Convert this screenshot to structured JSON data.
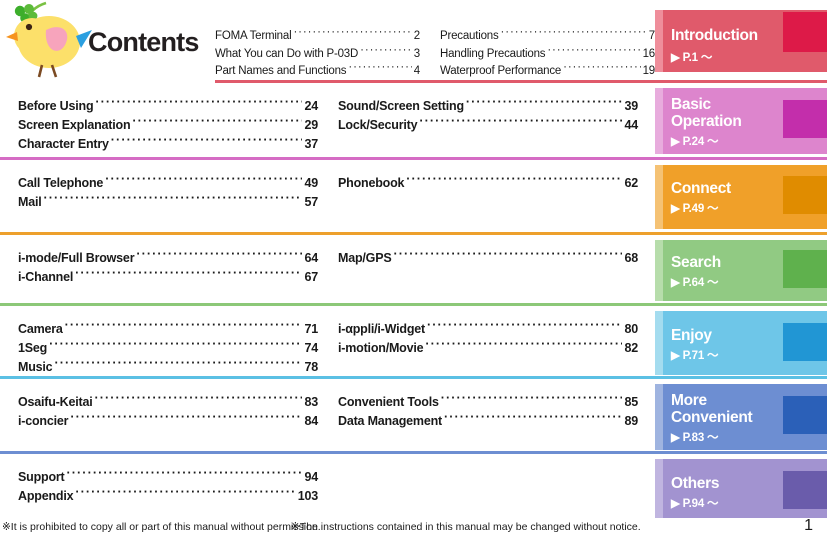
{
  "page": {
    "title": "Contents",
    "page_number": "1",
    "mascot_icon": "chick-with-clover-icon"
  },
  "footer": {
    "note_left": "※It is prohibited to copy all or part of this manual without permission.",
    "note_right": "※The instructions contained in this manual may be changed without notice."
  },
  "colors": {
    "introduction": "#e05a6b",
    "introduction_accent": "#ef8e9b",
    "introduction_square": "#dd1a48",
    "basic_operation": "#dd85cd",
    "basic_operation_accent": "#e8acdd",
    "basic_operation_square": "#c32eab",
    "connect": "#f0a029",
    "connect_accent": "#f5c274",
    "connect_square": "#e08c00",
    "search": "#91ca83",
    "search_accent": "#b7ddab",
    "search_square": "#5fb14d",
    "enjoy": "#6ec6e8",
    "enjoy_accent": "#a4dcef",
    "enjoy_square": "#2196d4",
    "more_convenient": "#6d8ed2",
    "more_convenient_accent": "#9fb4e0",
    "more_convenient_square": "#2b60b8",
    "others": "#a293d0",
    "others_accent": "#c0b5e0",
    "others_square": "#6a5cab"
  },
  "sections": [
    {
      "tab_label": "Introduction",
      "tab_page": "▶ P.1 ～",
      "rule_color": "#e05a6b",
      "left": [
        {
          "title": "FOMA Terminal",
          "page": "2"
        },
        {
          "title": "What You can Do with P-03D",
          "page": "3"
        },
        {
          "title": "Part Names and Functions",
          "page": "4"
        }
      ],
      "right": [
        {
          "title": "Precautions",
          "page": "7"
        },
        {
          "title": "Handling Precautions",
          "page": "16"
        },
        {
          "title": "Waterproof Performance",
          "page": "19"
        }
      ]
    },
    {
      "tab_label": "Basic Operation",
      "tab_page": "▶ P.24 ～",
      "rule_color": "#d56cc4",
      "left": [
        {
          "title": "Before Using",
          "page": "24"
        },
        {
          "title": "Screen Explanation",
          "page": "29"
        },
        {
          "title": "Character Entry",
          "page": "37"
        }
      ],
      "right": [
        {
          "title": "Sound/Screen Setting",
          "page": "39"
        },
        {
          "title": "Lock/Security",
          "page": "44"
        }
      ]
    },
    {
      "tab_label": "Connect",
      "tab_page": "▶ P.49 ～",
      "rule_color": "#eda02c",
      "left": [
        {
          "title": "Call Telephone",
          "page": "49"
        },
        {
          "title": "Mail",
          "page": "57"
        }
      ],
      "right": [
        {
          "title": "Phonebook",
          "page": "62"
        }
      ]
    },
    {
      "tab_label": "Search",
      "tab_page": "▶ P.64 ～",
      "rule_color": "#8cc878",
      "left": [
        {
          "title": "i-mode/Full Browser",
          "page": "64"
        },
        {
          "title": "i-Channel",
          "page": "67"
        }
      ],
      "right": [
        {
          "title": "Map/GPS",
          "page": "68"
        }
      ]
    },
    {
      "tab_label": "Enjoy",
      "tab_page": "▶ P.71 ～",
      "rule_color": "#5bc0e4",
      "left": [
        {
          "title": "Camera",
          "page": "71"
        },
        {
          "title": "1Seg",
          "page": "74"
        },
        {
          "title": "Music",
          "page": "78"
        }
      ],
      "right": [
        {
          "title": "i-αppli/i-Widget",
          "page": "80"
        },
        {
          "title": "i-motion/Movie",
          "page": "82"
        }
      ]
    },
    {
      "tab_label": "More Convenient",
      "tab_page": "▶ P.83 ～",
      "rule_color": "#6d8ed2",
      "left": [
        {
          "title": "Osaifu-Keitai",
          "page": "83"
        },
        {
          "title": "i-concier",
          "page": "84"
        }
      ],
      "right": [
        {
          "title": "Convenient Tools",
          "page": "85"
        },
        {
          "title": "Data Management",
          "page": "89"
        }
      ]
    },
    {
      "tab_label": "Others",
      "tab_page": "▶ P.94 ～",
      "rule_color": "#a293d0",
      "left": [
        {
          "title": "Support",
          "page": "94"
        },
        {
          "title": "Appendix",
          "page": "103"
        }
      ],
      "right": []
    }
  ]
}
